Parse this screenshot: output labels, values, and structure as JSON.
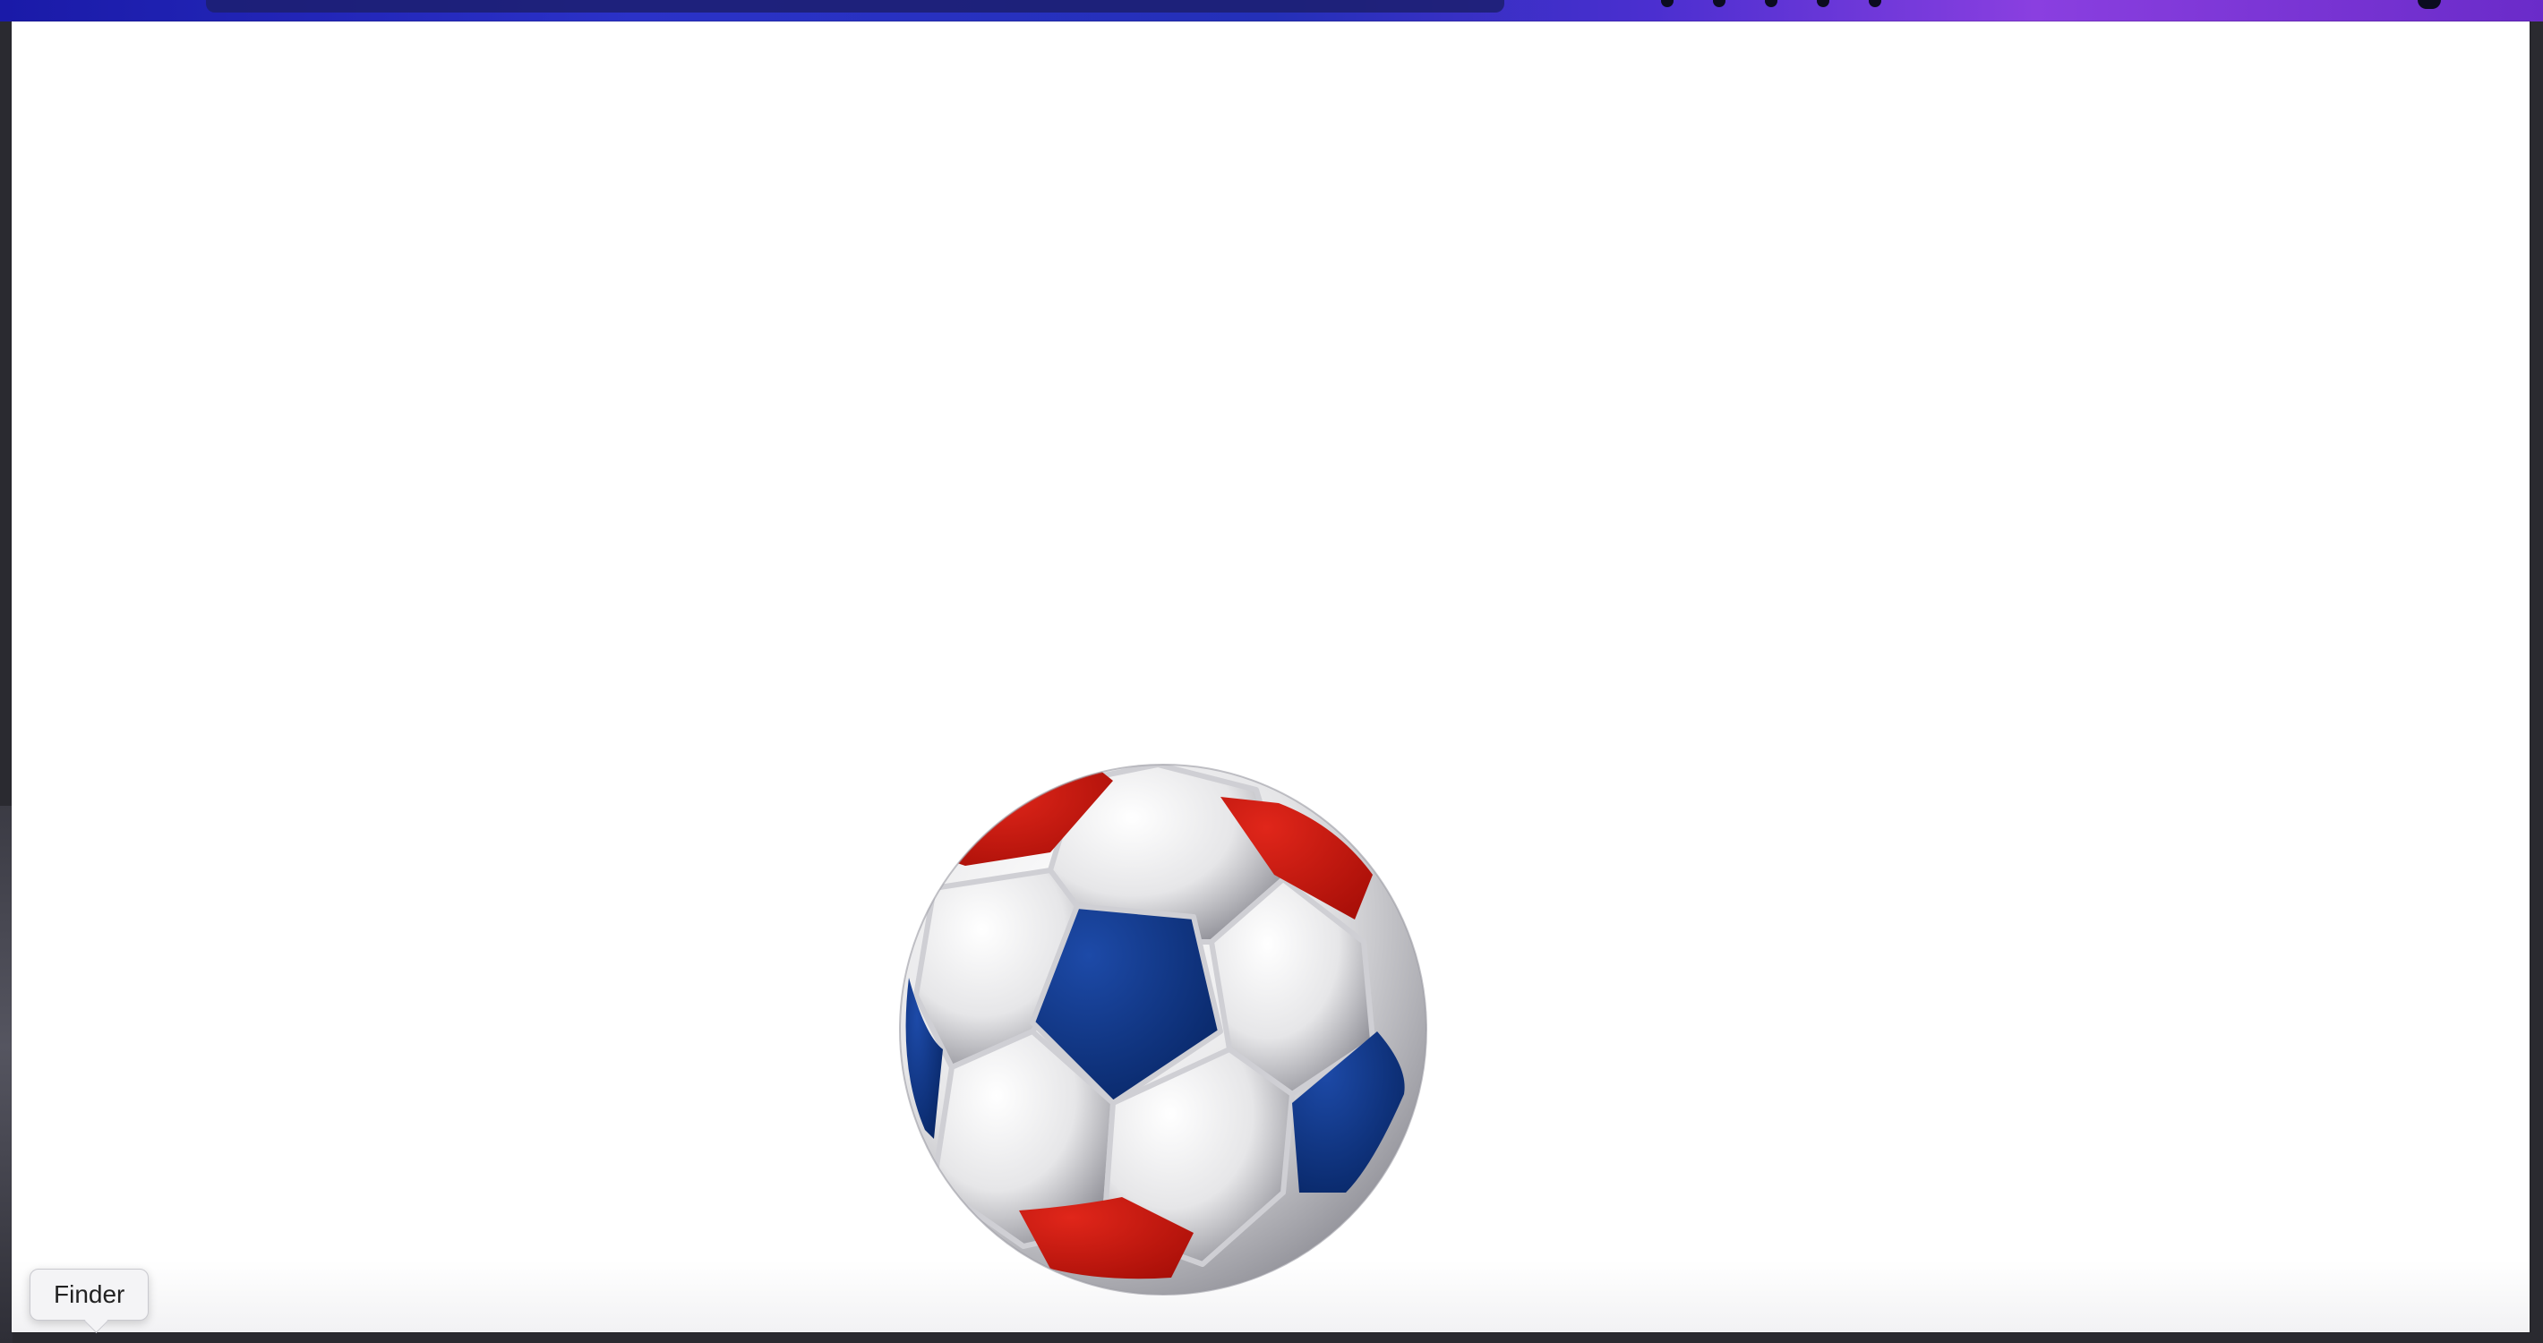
{
  "dock": {
    "tooltip_label": "Finder"
  },
  "content": {
    "image_subject": "soccer-ball",
    "colors": {
      "red_panel": "#c8180e",
      "blue_panel": "#0a2f7a",
      "white_panel": "#f0f0f0",
      "top_bar_start": "#1a1aa8",
      "top_bar_end": "#8a3fe0"
    }
  }
}
